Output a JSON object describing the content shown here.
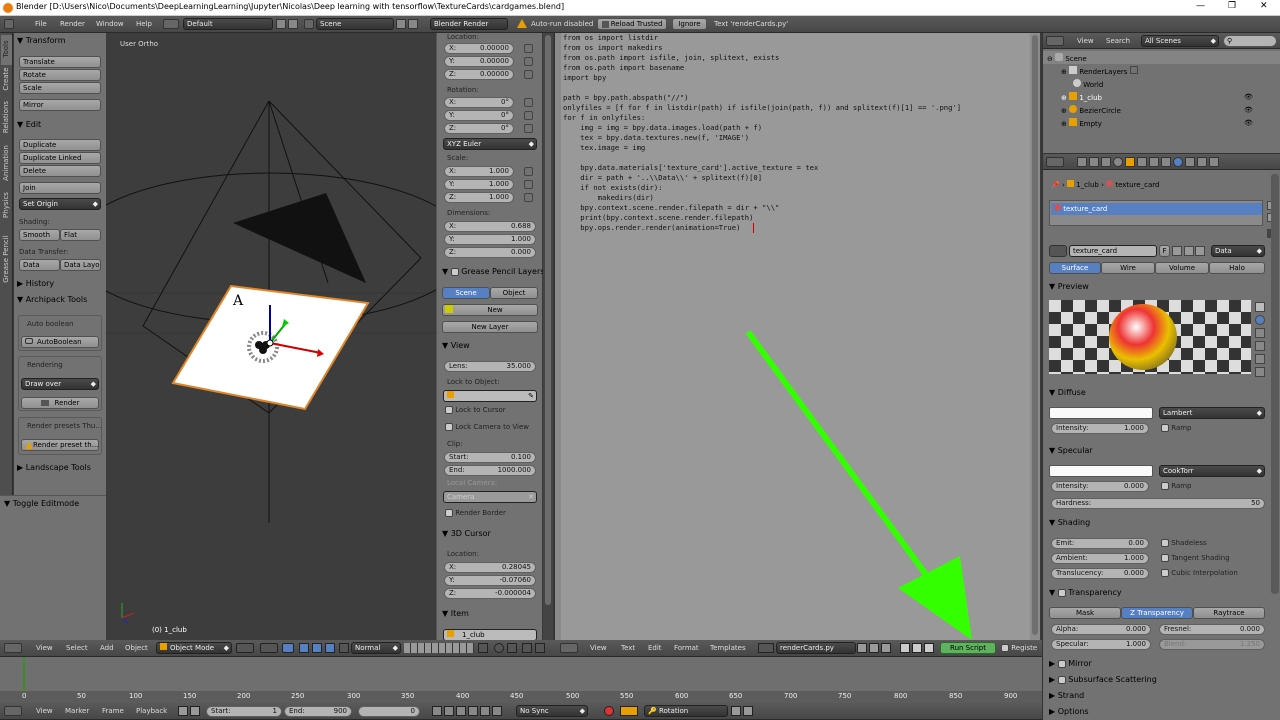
{
  "title_bar": {
    "title": "Blender [D:\\Users\\Nico\\Documents\\DeepLearningLearning\\Jupyter\\Nicolas\\Deep learning with tensorflow\\TextureCards\\cardgames.blend]",
    "min": "—",
    "max": "❐",
    "close": "✕"
  },
  "top_menu": {
    "items": [
      "File",
      "Render",
      "Window",
      "Help"
    ],
    "layout": "Default",
    "scene": "Scene",
    "engine": "Blender Render",
    "warning": "Auto-run disabled",
    "reload": "Reload Trusted",
    "ignore": "Ignore",
    "text_label": "Text 'renderCards.py'"
  },
  "tool_tabs": [
    "Tools",
    "Create",
    "Relations",
    "Animation",
    "Physics",
    "Grease Pencil"
  ],
  "tool_shelf": {
    "transform": "Transform",
    "transform_buttons": [
      "Translate",
      "Rotate",
      "Scale"
    ],
    "mirror": "Mirror",
    "edit": "Edit",
    "edit_buttons": [
      "Duplicate",
      "Duplicate Linked",
      "Delete"
    ],
    "join": "Join",
    "set_origin": "Set Origin",
    "shading": "Shading:",
    "smooth": "Smooth",
    "flat": "Flat",
    "data_transfer": "Data Transfer:",
    "data": "Data",
    "data_layo": "Data Layo",
    "history": "History",
    "archipack": "Archipack Tools",
    "auto_boolean_label": "Auto boolean",
    "auto_boolean_btn": "AutoBoolean",
    "rendering": "Rendering",
    "draw_over": "Draw over",
    "render": "Render",
    "render_presets": "Render presets Thu...",
    "render_preset_btn": "Render preset th...",
    "landscape": "Landscape Tools",
    "toggle_editmode": "Toggle Editmode"
  },
  "viewport": {
    "view_label": "User Ortho",
    "object_label": "(0) 1_club",
    "header": {
      "items": [
        "View",
        "Select",
        "Add",
        "Object"
      ],
      "mode": "Object Mode",
      "pivot": "Normal"
    }
  },
  "properties_n": {
    "location": "Location:",
    "loc": [
      [
        "X:",
        "0.00000"
      ],
      [
        "Y:",
        "0.00000"
      ],
      [
        "Z:",
        "0.00000"
      ]
    ],
    "rotation": "Rotation:",
    "rot": [
      [
        "X:",
        "0°"
      ],
      [
        "Y:",
        "0°"
      ],
      [
        "Z:",
        "0°"
      ]
    ],
    "euler": "XYZ Euler",
    "scale": "Scale:",
    "scl": [
      [
        "X:",
        "1.000"
      ],
      [
        "Y:",
        "1.000"
      ],
      [
        "Z:",
        "1.000"
      ]
    ],
    "dimensions": "Dimensions:",
    "dim": [
      [
        "X:",
        "0.688"
      ],
      [
        "Y:",
        "1.000"
      ],
      [
        "Z:",
        "0.000"
      ]
    ],
    "gp_layers": "Grease Pencil Layers",
    "gp_scene": "Scene",
    "gp_object": "Object",
    "gp_new": "New",
    "gp_new_layer": "New Layer",
    "view": "View",
    "lens_k": "Lens:",
    "lens_v": "35.000",
    "lock_to_object": "Lock to Object:",
    "lock_to_cursor": "Lock to Cursor",
    "lock_camera": "Lock Camera to View",
    "clip": "Clip:",
    "clip_start_k": "Start:",
    "clip_start_v": "0.100",
    "clip_end_k": "End:",
    "clip_end_v": "1000.000",
    "local_camera": "Local Camera:",
    "camera": "Camera",
    "render_border": "Render Border",
    "cursor_3d": "3D Cursor",
    "cursor_location": "Location:",
    "cur": [
      [
        "X:",
        "0.28045"
      ],
      [
        "Y:",
        "-0.07060"
      ],
      [
        "Z:",
        "-0.000004"
      ]
    ],
    "item": "Item",
    "item_name": "1_club"
  },
  "text_editor": {
    "code": "from os import listdir\nfrom os import makedirs\nfrom os.path import isfile, join, splitext, exists\nfrom os.path import basename\nimport bpy\n\npath = bpy.path.abspath(\"//\")\nonlyfiles = [f for f in listdir(path) if isfile(join(path, f)) and splitext(f)[1] == '.png']\nfor f in onlyfiles:\n    img = img = bpy.data.images.load(path + f)\n    tex = bpy.data.textures.new(f, 'IMAGE')\n    tex.image = img\n\n    bpy.data.materials['texture_card'].active_texture = tex\n    dir = path + '..\\\\Data\\\\' + splitext(f)[0]\n    if not exists(dir):\n        makedirs(dir)\n    bpy.context.scene.render.filepath = dir + \"\\\\\"\n    print(bpy.context.scene.render.filepath)\n    bpy.ops.render.render(animation=True)",
    "header": {
      "items": [
        "View",
        "Text",
        "Edit",
        "Format",
        "Templates"
      ],
      "file": "renderCards.py",
      "run_script": "Run Script",
      "register": "Registe"
    }
  },
  "outliner": {
    "view": "View",
    "search": "Search",
    "filter": "All Scenes",
    "items": [
      "Scene",
      "RenderLayers",
      "World",
      "1_club",
      "BezierCircle",
      "Empty"
    ]
  },
  "props": {
    "breadcrumb_obj": "1_club",
    "breadcrumb_mat": "texture_card",
    "material_slot": "texture_card",
    "material_name": "texture_card",
    "f_label": "F",
    "data": "Data",
    "tabs": [
      "Surface",
      "Wire",
      "Volume",
      "Halo"
    ],
    "preview": "Preview",
    "diffuse": "Diffuse",
    "lambert": "Lambert",
    "intensity_k": "Intensity:",
    "diffuse_intensity": "1.000",
    "ramp": "Ramp",
    "specular": "Specular",
    "cooktorr": "CookTorr",
    "specular_intensity": "0.000",
    "hardness_k": "Hardness:",
    "hardness_v": "50",
    "shading": "Shading",
    "emit_k": "Emit:",
    "emit_v": "0.00",
    "ambient_k": "Ambient:",
    "ambient_v": "1.000",
    "translucency_k": "Translucency:",
    "translucency_v": "0.000",
    "shadeless": "Shadeless",
    "tangent": "Tangent Shading",
    "cubic": "Cubic Interpolation",
    "transparency": "Transparency",
    "trans_tabs": [
      "Mask",
      "Z Transparency",
      "Raytrace"
    ],
    "alpha_k": "Alpha:",
    "alpha_v": "0.000",
    "fresnel_k": "Fresnel:",
    "fresnel_v": "0.000",
    "specular_k": "Specular:",
    "specular_v": "1.000",
    "blend_k": "Blend:",
    "blend_v": "1.250",
    "mirror": "Mirror",
    "sss": "Subsurface Scattering",
    "strand": "Strand",
    "options": "Options"
  },
  "timeline": {
    "ticks": [
      "0",
      "50",
      "100",
      "150",
      "200",
      "250",
      "300",
      "350",
      "400",
      "450",
      "500",
      "550",
      "600",
      "650",
      "700",
      "750",
      "800",
      "850",
      "900"
    ],
    "header": {
      "items": [
        "View",
        "Marker",
        "Frame",
        "Playback"
      ],
      "start_k": "Start:",
      "start_v": "1",
      "end_k": "End:",
      "end_v": "900",
      "current": "0",
      "sync": "No Sync",
      "keying": "Rotation"
    }
  },
  "colors": {
    "accent": "#5680c2",
    "arrow": "#33ff00",
    "run_script": "#5fb35f"
  }
}
